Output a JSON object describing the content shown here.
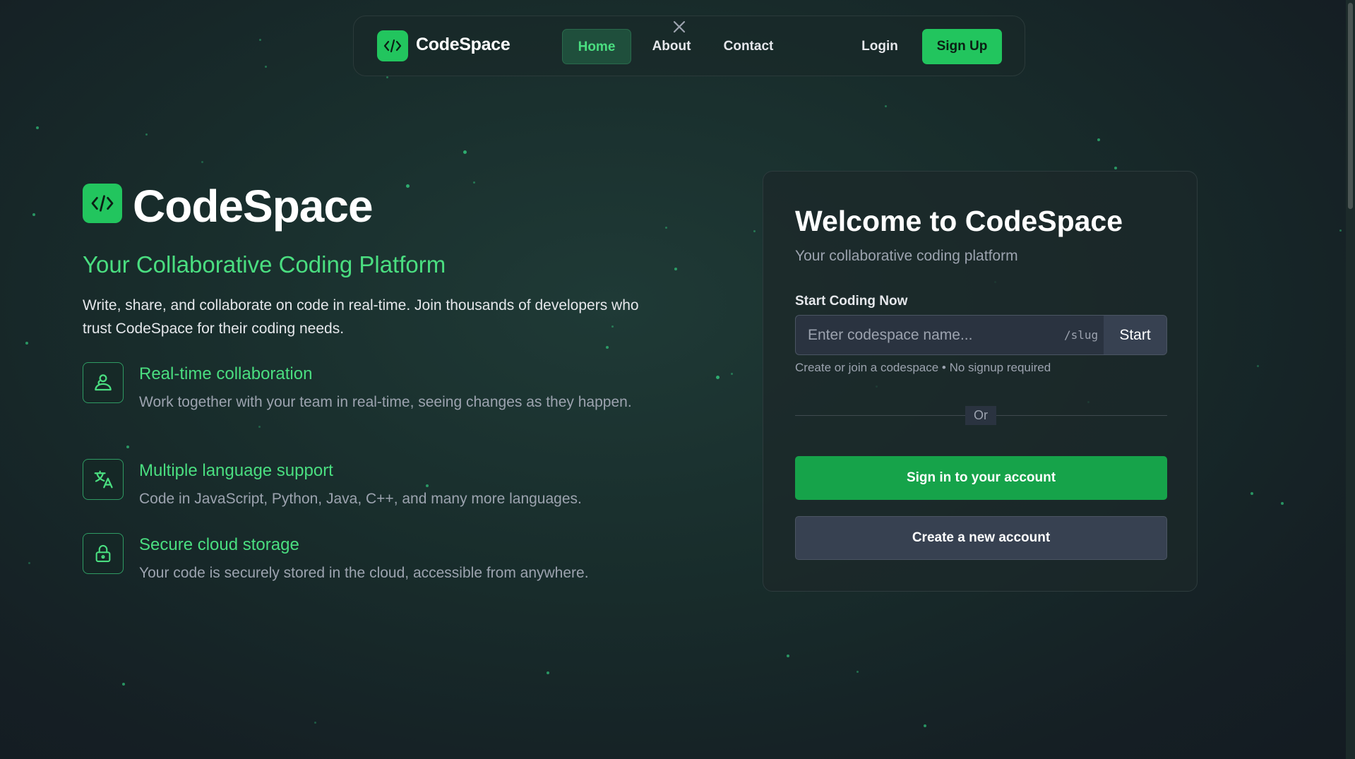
{
  "nav": {
    "brand": "CodeSpace",
    "links": [
      "Home",
      "About",
      "Contact"
    ],
    "login": "Login",
    "signup": "Sign Up",
    "logo_icon": "code-icon",
    "close_icon": "close-icon"
  },
  "hero": {
    "title": "CodeSpace",
    "subtitle": "Your Collaborative Coding Platform",
    "description": "Write, share, and collaborate on code in real-time. Join thousands of developers who trust CodeSpace for their coding needs.",
    "features": [
      {
        "icon": "users-icon",
        "title": "Real-time collaboration",
        "description": "Work together with your team in real-time, seeing changes as they happen."
      },
      {
        "icon": "translate-icon",
        "title": "Multiple language support",
        "description": "Code in JavaScript, Python, Java, C++, and many more languages."
      },
      {
        "icon": "lock-icon",
        "title": "Secure cloud storage",
        "description": "Your code is securely stored in the cloud, accessible from anywhere."
      }
    ]
  },
  "card": {
    "title": "Welcome to CodeSpace",
    "subtitle": "Your collaborative coding platform",
    "label": "Start Coding Now",
    "input_placeholder": "Enter codespace name...",
    "input_value": "",
    "slug": "/slug",
    "start": "Start",
    "hint": "Create or join a codespace • No signup required",
    "or": "Or",
    "signin": "Sign in to your account",
    "create": "Create a new account"
  },
  "colors": {
    "accent": "#22c55e",
    "accent_text": "#4ade80",
    "background": "#182c2b",
    "card": "#1c282a",
    "muted_text": "#9ca3af"
  }
}
